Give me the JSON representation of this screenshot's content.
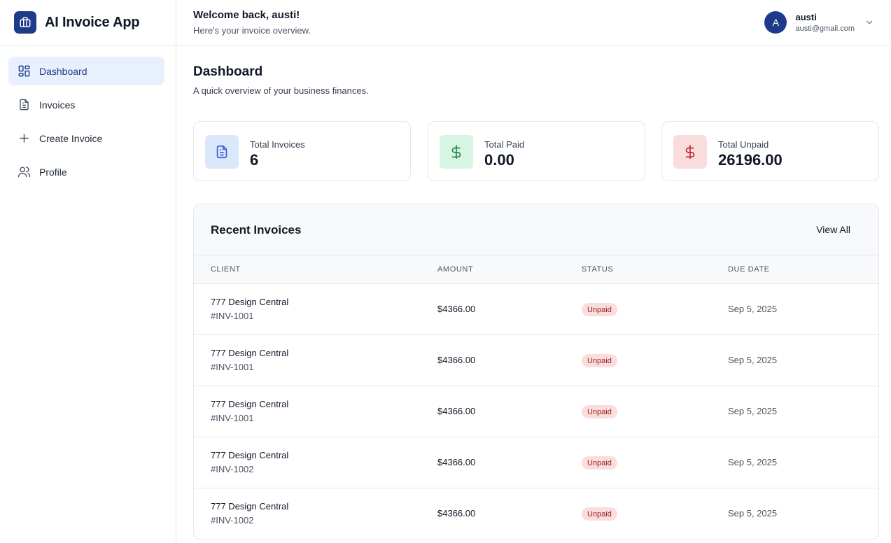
{
  "app": {
    "title": "AI Invoice App"
  },
  "sidebar": {
    "items": [
      {
        "label": "Dashboard",
        "icon": "dashboard-grid-icon",
        "active": true
      },
      {
        "label": "Invoices",
        "icon": "document-icon",
        "active": false
      },
      {
        "label": "Create Invoice",
        "icon": "plus-icon",
        "active": false
      },
      {
        "label": "Profile",
        "icon": "users-icon",
        "active": false
      }
    ]
  },
  "header": {
    "welcome": "Welcome back, austi!",
    "subtitle": "Here's your invoice overview.",
    "user": {
      "initial": "A",
      "name": "austi",
      "email": "austi@gmail.com"
    }
  },
  "main": {
    "title": "Dashboard",
    "subtitle": "A quick overview of your business finances.",
    "stats": [
      {
        "label": "Total Invoices",
        "value": "6",
        "icon": "document-icon",
        "color": "#3b5bdb",
        "bg": "#dbe7fb"
      },
      {
        "label": "Total Paid",
        "value": "0.00",
        "icon": "dollar-icon",
        "color": "#1f8a4c",
        "bg": "#d7f5e3"
      },
      {
        "label": "Total Unpaid",
        "value": "26196.00",
        "icon": "dollar-icon",
        "color": "#c0262d",
        "bg": "#f9dddd"
      }
    ],
    "recent": {
      "title": "Recent Invoices",
      "view_all": "View All",
      "columns": [
        "Client",
        "Amount",
        "Status",
        "Due Date"
      ],
      "rows": [
        {
          "client": "777 Design Central",
          "id": "#INV-1001",
          "amount": "$4366.00",
          "status": "Unpaid",
          "due": "Sep 5, 2025"
        },
        {
          "client": "777 Design Central",
          "id": "#INV-1001",
          "amount": "$4366.00",
          "status": "Unpaid",
          "due": "Sep 5, 2025"
        },
        {
          "client": "777 Design Central",
          "id": "#INV-1001",
          "amount": "$4366.00",
          "status": "Unpaid",
          "due": "Sep 5, 2025"
        },
        {
          "client": "777 Design Central",
          "id": "#INV-1002",
          "amount": "$4366.00",
          "status": "Unpaid",
          "due": "Sep 5, 2025"
        },
        {
          "client": "777 Design Central",
          "id": "#INV-1002",
          "amount": "$4366.00",
          "status": "Unpaid",
          "due": "Sep 5, 2025"
        }
      ]
    }
  },
  "colors": {
    "accent": "#1e3a8a",
    "active_bg": "#e8f0fd",
    "badge_bg": "#fadedd",
    "badge_text": "#9b1c1c"
  }
}
